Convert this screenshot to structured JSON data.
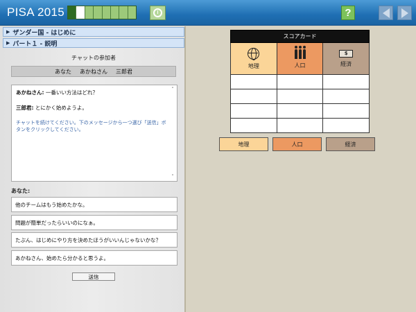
{
  "app": {
    "title": "PISA 2015"
  },
  "progress": {
    "total_segments": 8,
    "done_segments": 1,
    "current_segment": 2
  },
  "nav": {
    "help_label": "?"
  },
  "sections": [
    {
      "label": "ザンダー国 - はじめに"
    },
    {
      "label": "パート１ - 説明"
    }
  ],
  "participants": {
    "title": "チャットの参加者",
    "names": [
      "あなた",
      "あかねさん",
      "三郎君"
    ]
  },
  "chat": {
    "messages": [
      {
        "speaker": "あかねさん:",
        "text": "一番いい方法はどれ？"
      },
      {
        "speaker": "三郎君:",
        "text": "とにかく始めようよ。"
      }
    ],
    "instruction": "チャットを続けてください。下のメッセージから一つ選び「送信」ボタンをクリックしてください。"
  },
  "reply": {
    "label": "あなた:",
    "options": [
      "他のチームはもう始めたかな。",
      "問題が簡単だったらいいのになぁ。",
      "たぶん、はじめにやり方を決めたほうがいいんじゃないかな？",
      "あかねさん、始めたら分かると思うよ。"
    ],
    "send_label": "送信"
  },
  "scorecard": {
    "title": "スコアカード",
    "categories": [
      {
        "label": "地理",
        "icon": "globe-icon",
        "color": "#fbd598"
      },
      {
        "label": "人口",
        "icon": "people-icon",
        "color": "#ec9961"
      },
      {
        "label": "経済",
        "icon": "money-icon",
        "color": "#b9a08a",
        "icon_text": "$"
      }
    ],
    "rows": 4
  },
  "category_buttons": [
    "地理",
    "人口",
    "経済"
  ],
  "colors": {
    "topbar": "#1f6fb3",
    "progress_done": "#2e6b22",
    "help": "#7dc25b"
  }
}
